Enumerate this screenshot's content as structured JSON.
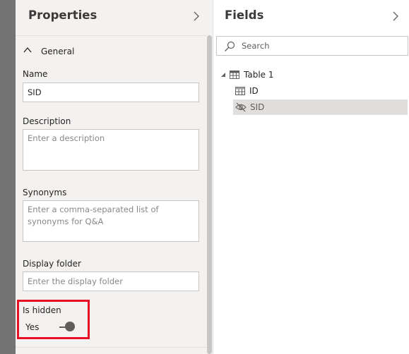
{
  "properties": {
    "title": "Properties",
    "section": {
      "title": "General",
      "expanded": true
    },
    "name": {
      "label": "Name",
      "value": "SID"
    },
    "description": {
      "label": "Description",
      "placeholder": "Enter a description"
    },
    "synonyms": {
      "label": "Synonyms",
      "placeholder": "Enter a comma-separated list of synonyms for Q&A"
    },
    "display_folder": {
      "label": "Display folder",
      "placeholder": "Enter the display folder"
    },
    "is_hidden": {
      "label": "Is hidden",
      "value_label": "Yes",
      "on": true
    }
  },
  "fields": {
    "title": "Fields",
    "search": {
      "placeholder": "Search"
    },
    "table": {
      "name": "Table 1",
      "expanded": true,
      "columns": [
        {
          "name": "ID",
          "icon": "table-column-icon",
          "hidden": false,
          "selected": false
        },
        {
          "name": "SID",
          "icon": "hidden-eye-icon",
          "hidden": true,
          "selected": true
        }
      ]
    }
  },
  "colors": {
    "highlight": "#e81123",
    "pane_background": "#f3f2f1",
    "selected_row": "#e1dfdd",
    "left_strip": "#737373"
  }
}
